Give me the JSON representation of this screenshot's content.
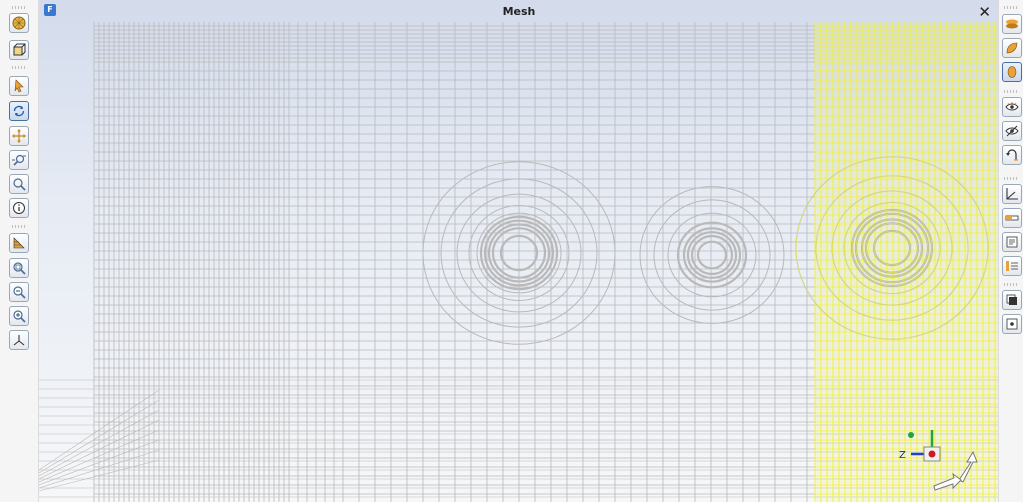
{
  "window": {
    "title": "Mesh",
    "logo_letter": "F",
    "close_glyph": "✕"
  },
  "left_toolbar": [
    "mesh-view-button",
    "wireframe-box-button",
    "select-arrow-button",
    "rotate-view-button",
    "pan-view-button",
    "zoom-region-button",
    "zoom-button",
    "info-button",
    "render-mode-button",
    "zoom-fit-button",
    "zoom-out-button",
    "zoom-in-button",
    "axes-triad-button"
  ],
  "right_toolbar": [
    "shade-surface-button",
    "shade-solid-button",
    "color-fill-button",
    "visibility-eye-button",
    "hide-eye-button",
    "undo-view-button",
    "axis-toggle-button",
    "scale-bar-button",
    "annotation-button",
    "legend-button",
    "transparency-button",
    "point-marker-button"
  ],
  "colors": {
    "mesh_line": "#b9b9b9",
    "highlight": "#f2f22a",
    "axis_x": "#1e3fd8",
    "axis_y": "#22a63a",
    "origin_marker": "#cc1c1c"
  },
  "triad": {
    "z_label": "Z"
  }
}
